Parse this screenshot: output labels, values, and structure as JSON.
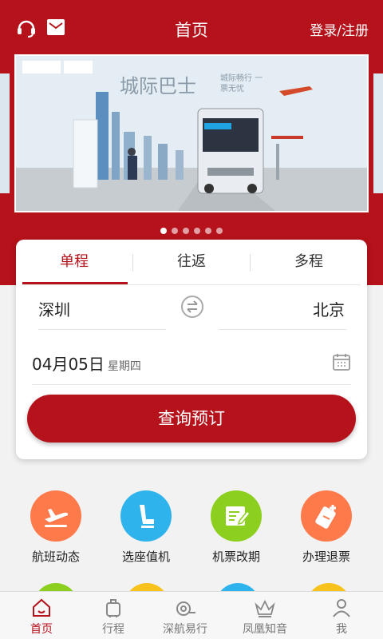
{
  "header": {
    "title": "首页",
    "login_label": "登录/注册",
    "left_icons": [
      "customer-service-icon",
      "message-icon"
    ]
  },
  "banner": {
    "headline": "城际巴士",
    "tagline": "城际畅行 一票无忧",
    "dot_count": 6,
    "active_dot": 0
  },
  "booking": {
    "tabs": [
      "单程",
      "往返",
      "多程"
    ],
    "active_tab": 0,
    "from_city": "深圳",
    "to_city": "北京",
    "date": "04月05日",
    "weekday": "星期四",
    "search_label": "查询预订"
  },
  "services": [
    {
      "label": "航班动态",
      "icon": "plane-landing-icon",
      "color": "#ff7a4a"
    },
    {
      "label": "选座值机",
      "icon": "seat-icon",
      "color": "#2fb3ec"
    },
    {
      "label": "机票改期",
      "icon": "edit-ticket-icon",
      "color": "#8ccf1e"
    },
    {
      "label": "办理退票",
      "icon": "refund-ticket-icon",
      "color": "#ff7a4a"
    }
  ],
  "tabbar": [
    {
      "label": "首页",
      "icon": "home-icon",
      "active": true
    },
    {
      "label": "行程",
      "icon": "luggage-icon",
      "active": false
    },
    {
      "label": "深航易行",
      "icon": "shenzhen-airlines-icon",
      "active": false
    },
    {
      "label": "凤凰知音",
      "icon": "crown-icon",
      "active": false
    },
    {
      "label": "我",
      "icon": "user-icon",
      "active": false
    }
  ],
  "colors": {
    "brand": "#b5121b",
    "orange": "#ff7a4a",
    "blue": "#2fb3ec",
    "green": "#8ccf1e",
    "yellow": "#f7c21b"
  }
}
